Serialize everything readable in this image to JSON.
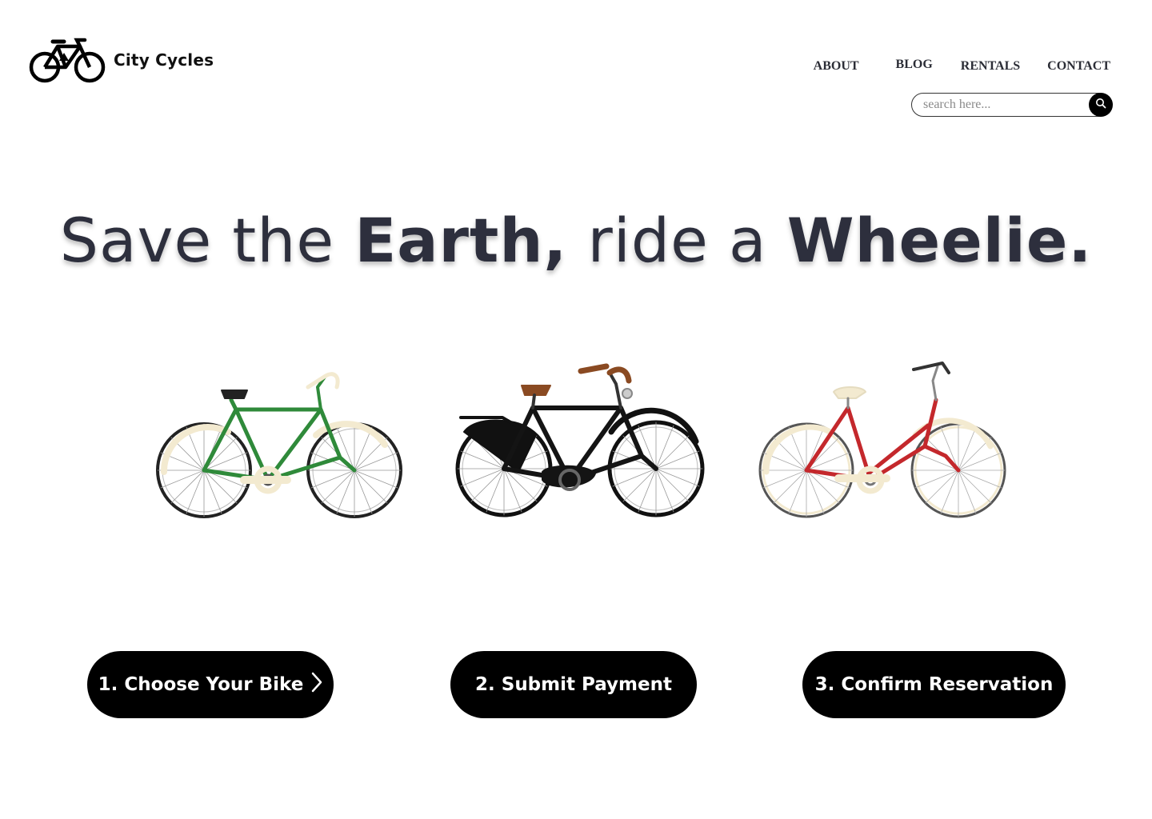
{
  "brand": {
    "name": "City Cycles",
    "logo_icon": "bicycle-icon"
  },
  "nav": {
    "items": [
      {
        "label": "ABOUT"
      },
      {
        "label": "BLOG"
      },
      {
        "label": "RENTALS"
      },
      {
        "label": "CONTACT"
      }
    ]
  },
  "search": {
    "placeholder": "search here...",
    "icon": "search-icon"
  },
  "hero": {
    "part1": "Save the ",
    "part2": "Earth,",
    "part3": " ride a ",
    "part4": "Wheelie."
  },
  "bikes": [
    {
      "name": "green-bicycle",
      "frame_color": "#2f8a3a"
    },
    {
      "name": "black-bicycle",
      "frame_color": "#1a1a1a"
    },
    {
      "name": "red-bicycle",
      "frame_color": "#c4282c"
    }
  ],
  "steps": [
    {
      "label": "1. Choose Your Bike",
      "icon": "chevron-right-icon"
    },
    {
      "label": "2. Submit Payment"
    },
    {
      "label": "3. Confirm Reservation"
    }
  ],
  "colors": {
    "text": "#2d2f3d",
    "button_bg": "#000000",
    "button_text": "#ffffff"
  }
}
